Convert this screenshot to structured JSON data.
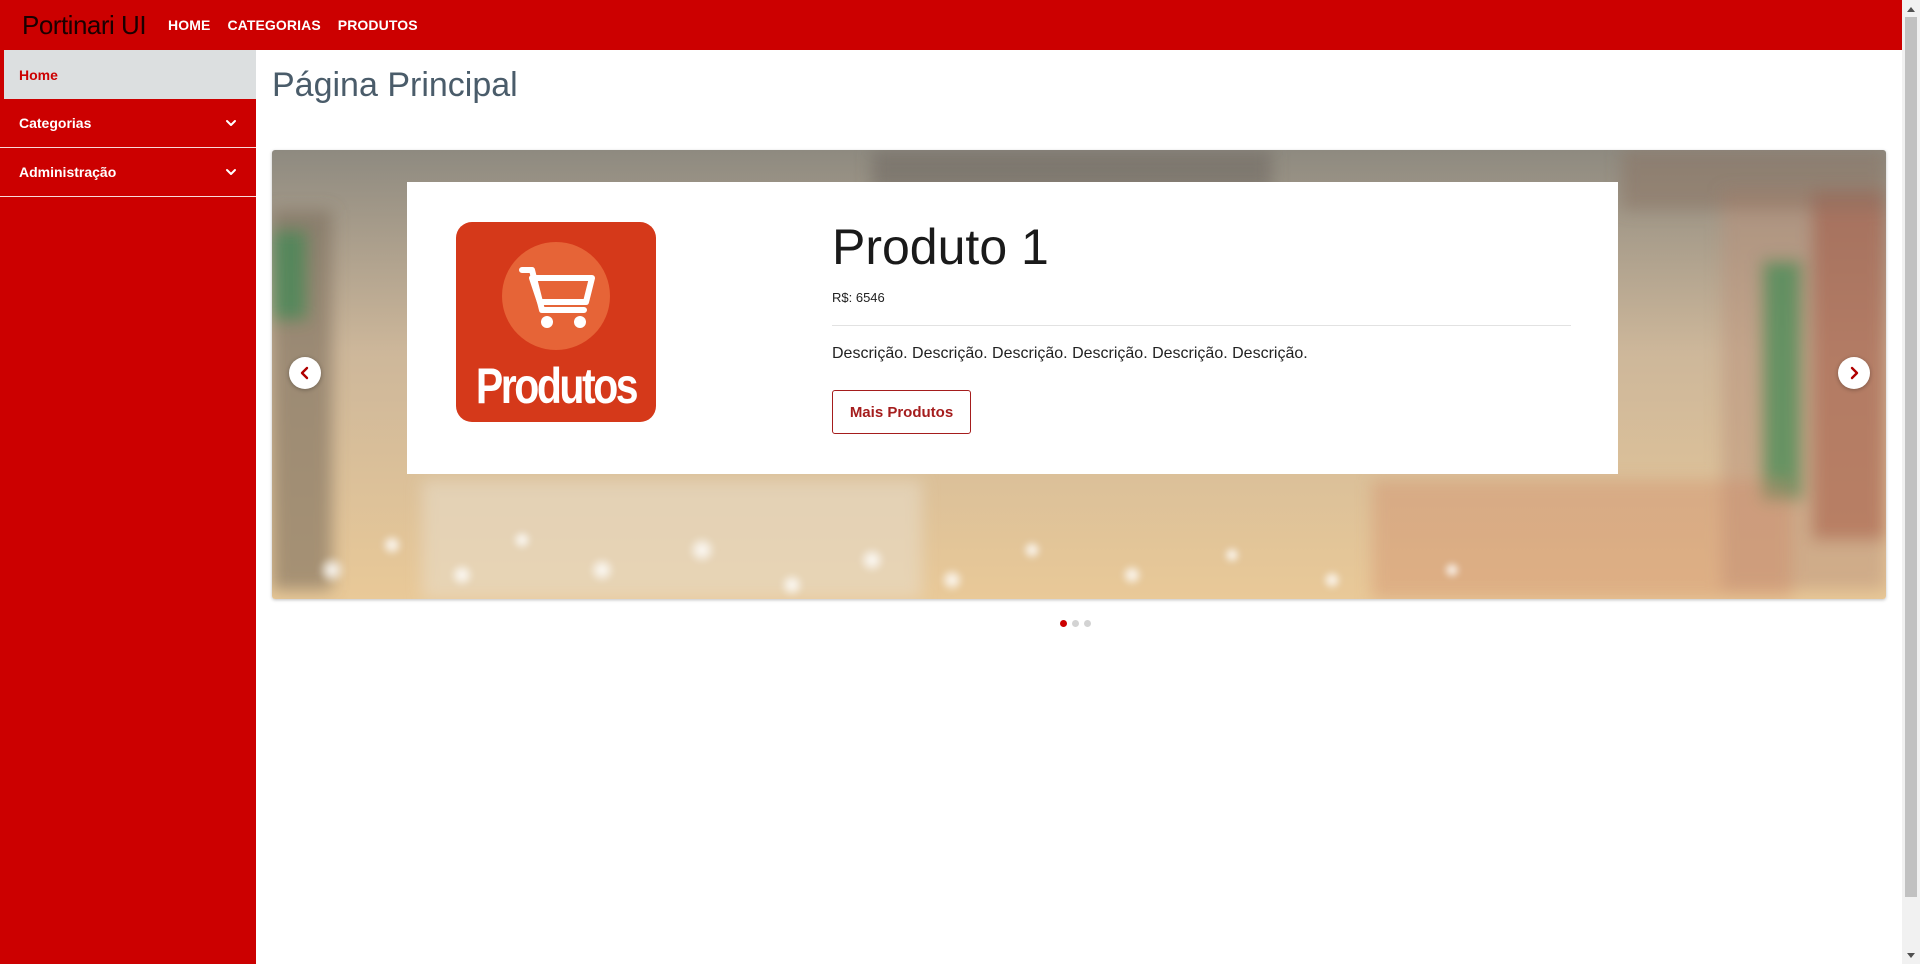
{
  "app": {
    "brand": "Portinari UI"
  },
  "topnav": {
    "items": [
      {
        "label": "HOME"
      },
      {
        "label": "CATEGORIAS"
      },
      {
        "label": "PRODUTOS"
      }
    ]
  },
  "sidebar": {
    "items": [
      {
        "label": "Home",
        "active": true,
        "expandable": false
      },
      {
        "label": "Categorias",
        "active": false,
        "expandable": true
      },
      {
        "label": "Administração",
        "active": false,
        "expandable": true
      }
    ]
  },
  "main": {
    "title": "Página Principal",
    "carousel": {
      "slide": {
        "logo_text": "Produtos",
        "title": "Produto 1",
        "price": "R$: 6546",
        "description": "Descrição. Descrição. Descrição. Descrição. Descrição. Descrição.",
        "button_label": "Mais Produtos"
      },
      "slide_count": 3,
      "active_slide": 1
    }
  },
  "colors": {
    "primary": "#cc0000",
    "active_bg": "#dcdfe0",
    "title_text": "#4a5c6a",
    "logo_bg": "#d5391a",
    "button_border": "#a51d1d"
  },
  "icons": {
    "sidebar_expand": "chevron-down-icon",
    "carousel_prev": "chevron-left-icon",
    "carousel_next": "chevron-right-icon",
    "logo": "shopping-cart-icon"
  }
}
